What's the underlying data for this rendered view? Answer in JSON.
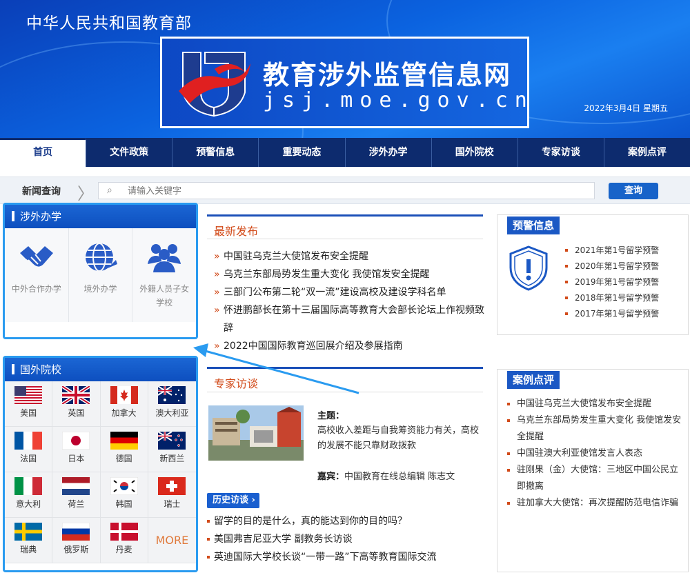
{
  "banner": {
    "ministry": "中华人民共和国教育部",
    "site_title": "教育涉外监管信息网",
    "site_domain": "jsj.moe.gov.cn",
    "date": "2022年3月4日 星期五"
  },
  "nav": {
    "items": [
      "首页",
      "文件政策",
      "预警信息",
      "重要动态",
      "涉外办学",
      "国外院校",
      "专家访谈",
      "案例点评"
    ],
    "active_index": 0
  },
  "search": {
    "label": "新闻查询",
    "placeholder": "请输入关键字",
    "button": "查询"
  },
  "abroad": {
    "title": "涉外办学",
    "items": [
      {
        "label": "中外合作办学",
        "icon": "handshake-icon"
      },
      {
        "label": "境外办学",
        "icon": "globe-icon"
      },
      {
        "label": "外籍人员子女学校",
        "icon": "people-icon"
      }
    ]
  },
  "foreign": {
    "title": "国外院校",
    "countries": [
      {
        "name": "美国",
        "flag": "us-flag-icon"
      },
      {
        "name": "英国",
        "flag": "uk-flag-icon"
      },
      {
        "name": "加拿大",
        "flag": "canada-flag-icon"
      },
      {
        "name": "澳大利亚",
        "flag": "australia-flag-icon"
      },
      {
        "name": "法国",
        "flag": "france-flag-icon"
      },
      {
        "name": "日本",
        "flag": "japan-flag-icon"
      },
      {
        "name": "德国",
        "flag": "germany-flag-icon"
      },
      {
        "name": "新西兰",
        "flag": "newzealand-flag-icon"
      },
      {
        "name": "意大利",
        "flag": "italy-flag-icon"
      },
      {
        "name": "荷兰",
        "flag": "netherlands-flag-icon"
      },
      {
        "name": "韩国",
        "flag": "korea-flag-icon"
      },
      {
        "name": "瑞士",
        "flag": "switzerland-flag-icon"
      },
      {
        "name": "瑞典",
        "flag": "sweden-flag-icon"
      },
      {
        "name": "俄罗斯",
        "flag": "russia-flag-icon"
      },
      {
        "name": "丹麦",
        "flag": "denmark-flag-icon"
      }
    ],
    "more": "MORE"
  },
  "latest": {
    "title": "最新发布",
    "items": [
      "中国驻乌克兰大使馆发布安全提醒",
      "乌克兰东部局势发生重大变化 我使馆发安全提醒",
      "三部门公布第二轮“双一流”建设高校及建设学科名单",
      "怀进鹏部长在第十三届国际高等教育大会部长论坛上作视频致辞",
      "2022中国国际教育巡回展介绍及参展指南"
    ]
  },
  "expert": {
    "title": "专家访谈",
    "theme_label": "主题：",
    "theme": "高校收入差距与自我筹资能力有关，高校的发展不能只靠财政拨款",
    "guest_label": "嘉宾：",
    "guest": "中国教育在线总编辑 陈志文",
    "history_button": "历史访谈 ›",
    "history": [
      "留学的目的是什么，真的能达到你的目的吗？",
      "美国弗吉尼亚大学 副教务长访谈",
      "英迪国际大学校长谈“一带一路”下高等教育国际交流"
    ]
  },
  "warnings": {
    "title": "预警信息",
    "items": [
      "2021年第1号留学预警",
      "2020年第1号留学预警",
      "2019年第1号留学预警",
      "2018年第1号留学预警",
      "2017年第1号留学预警"
    ]
  },
  "cases": {
    "title": "案例点评",
    "items": [
      "中国驻乌克兰大使馆发布安全提醒",
      "乌克兰东部局势发生重大变化 我使馆发安全提醒",
      "中国驻澳大利亚使馆发言人表态",
      "驻刚果（金）大使馆：三地区中国公民立即撤离",
      "驻加拿大大使馆：再次提醒防范电信诈骗"
    ]
  },
  "colors": {
    "brand_blue": "#0d4fbf",
    "nav_bg": "#0d2b6e",
    "accent_orange": "#d24b1a",
    "highlight_border": "#2a9bf0"
  }
}
